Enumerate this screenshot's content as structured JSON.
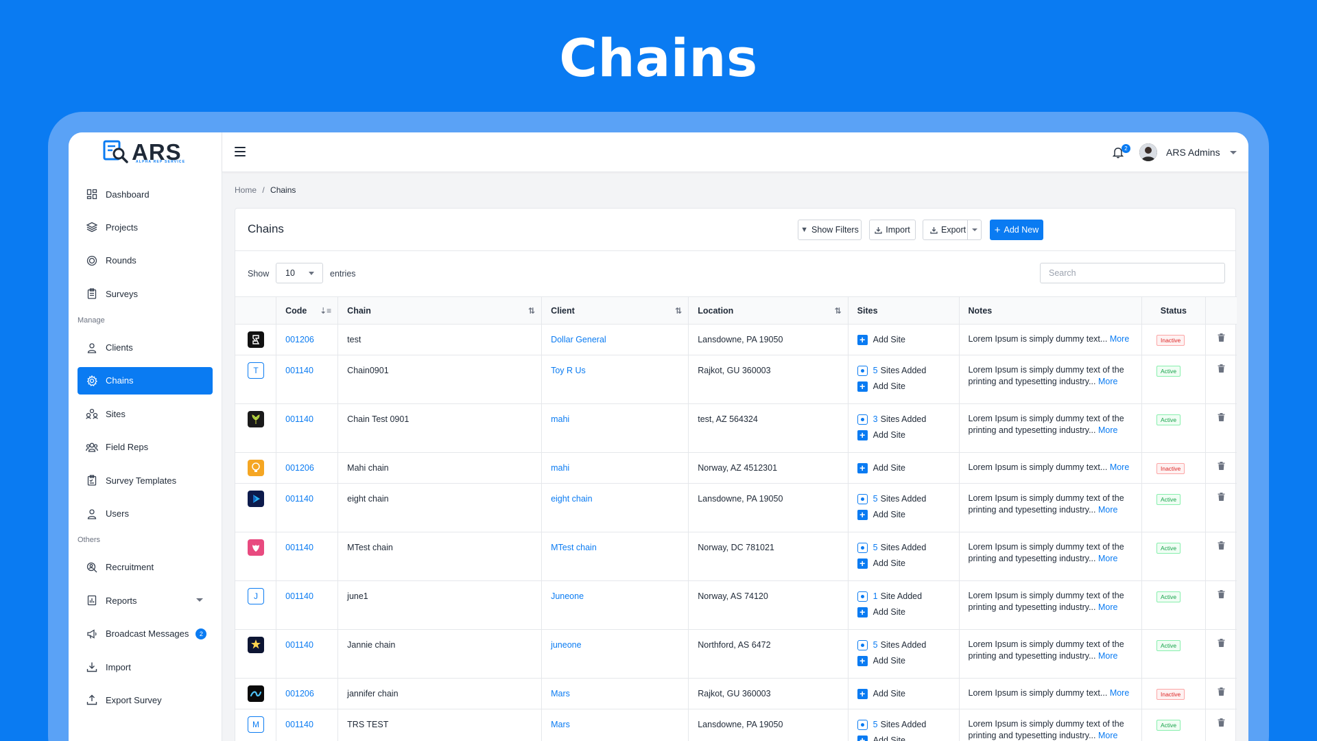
{
  "hero": {
    "title": "Chains"
  },
  "brand": {
    "name": "ARS",
    "tagline": "ALPHA REP SERVICE"
  },
  "sidebar": {
    "items": [
      {
        "label": "Dashboard",
        "icon": "dashboard-icon"
      },
      {
        "label": "Projects",
        "icon": "layers-icon"
      },
      {
        "label": "Rounds",
        "icon": "target-icon"
      },
      {
        "label": "Surveys",
        "icon": "clipboard-icon"
      }
    ],
    "section_manage": "Manage",
    "manage_items": [
      {
        "label": "Clients",
        "icon": "user-icon"
      },
      {
        "label": "Chains",
        "icon": "gear-icon",
        "active": true
      },
      {
        "label": "Sites",
        "icon": "sites-icon"
      },
      {
        "label": "Field Reps",
        "icon": "users-icon"
      },
      {
        "label": "Survey Templates",
        "icon": "clipboard-check-icon"
      },
      {
        "label": "Users",
        "icon": "user-icon"
      }
    ],
    "section_others": "Others",
    "other_items": [
      {
        "label": "Recruitment",
        "icon": "search-user-icon"
      },
      {
        "label": "Reports",
        "icon": "report-icon"
      },
      {
        "label": "Broadcast Messages",
        "icon": "megaphone-icon",
        "badge": "2"
      },
      {
        "label": "Import",
        "icon": "download-icon"
      },
      {
        "label": "Export Survey",
        "icon": "upload-icon"
      }
    ]
  },
  "topbar": {
    "notification_count": "2",
    "user_name": "ARS Admins"
  },
  "breadcrumb": {
    "home": "Home",
    "separator": "/",
    "current": "Chains"
  },
  "page": {
    "title": "Chains",
    "buttons": {
      "filters": "Show Filters",
      "import": "Import",
      "export": "Export",
      "add_new": "Add New"
    },
    "show_label": "Show",
    "entries_value": "10",
    "entries_label": "entries",
    "search_placeholder": "Search"
  },
  "table": {
    "columns": [
      "Code",
      "Chain",
      "Client",
      "Location",
      "Sites",
      "Notes",
      "Status"
    ],
    "add_site_label": "Add Site",
    "more_label": "More",
    "rows": [
      {
        "code": "001206",
        "chain": "test",
        "client": "Dollar General",
        "location": "Lansdowne, PA 19050",
        "sites_count": "",
        "sites_text": "",
        "notes": "Lorem Ipsum is simply dummy text...",
        "status": "Inactive",
        "logo": "dark",
        "logo_color": "#111111"
      },
      {
        "code": "001140",
        "chain": "Chain0901",
        "client": "Toy R Us",
        "location": "Rajkot, GU 360003",
        "sites_count": "5",
        "sites_text": "Sites Added",
        "notes": "Lorem Ipsum is simply dummy text of the printing and typesetting industry...",
        "status": "Active",
        "logo": "T",
        "logo_color": "#0a7bf2"
      },
      {
        "code": "001140",
        "chain": "Chain Test 0901",
        "client": "mahi",
        "location": "test, AZ 564324",
        "sites_count": "3",
        "sites_text": "Sites Added",
        "notes": "Lorem Ipsum is simply dummy text of the printing and typesetting industry...",
        "status": "Active",
        "logo": "leaf",
        "logo_color": "#1a1a1a"
      },
      {
        "code": "001206",
        "chain": "Mahi chain",
        "client": "mahi",
        "location": "Norway, AZ 4512301",
        "sites_count": "",
        "sites_text": "",
        "notes": "Lorem Ipsum is simply dummy text...",
        "status": "Inactive",
        "logo": "bulb",
        "logo_color": "#f5a623"
      },
      {
        "code": "001140",
        "chain": "eight chain",
        "client": "eight chain",
        "location": "Lansdowne, PA 19050",
        "sites_count": "5",
        "sites_text": "Sites Added",
        "notes": "Lorem Ipsum is simply dummy text of the printing and typesetting industry...",
        "status": "Active",
        "logo": "play",
        "logo_color": "#0d1b4c"
      },
      {
        "code": "001140",
        "chain": "MTest chain",
        "client": "MTest chain",
        "location": "Norway, DC 781021",
        "sites_count": "5",
        "sites_text": "Sites Added",
        "notes": "Lorem Ipsum is simply dummy text of the printing and typesetting industry...",
        "status": "Active",
        "logo": "pink",
        "logo_color": "#e84a7f"
      },
      {
        "code": "001140",
        "chain": "june1",
        "client": "Juneone",
        "location": "Norway, AS 74120",
        "sites_count": "1",
        "sites_text": "Site Added",
        "notes": "Lorem Ipsum is simply dummy text of the printing and typesetting industry...",
        "status": "Active",
        "logo": "J",
        "logo_color": "#0a7bf2"
      },
      {
        "code": "001140",
        "chain": "Jannie chain",
        "client": "juneone",
        "location": "Northford, AS 6472",
        "sites_count": "5",
        "sites_text": "Sites Added",
        "notes": "Lorem Ipsum is simply dummy text of the printing and typesetting industry...",
        "status": "Active",
        "logo": "star",
        "logo_color": "#0d1533"
      },
      {
        "code": "001206",
        "chain": "jannifer chain",
        "client": "Mars",
        "location": "Rajkot, GU 360003",
        "sites_count": "",
        "sites_text": "",
        "notes": "Lorem Ipsum is simply dummy text...",
        "status": "Inactive",
        "logo": "wave",
        "logo_color": "#0a0a0a"
      },
      {
        "code": "001140",
        "chain": "TRS TEST",
        "client": "Mars",
        "location": "Lansdowne, PA 19050",
        "sites_count": "5",
        "sites_text": "Sites Added",
        "notes": "Lorem Ipsum is simply dummy text of the printing and typesetting industry...",
        "status": "Active",
        "logo": "M",
        "logo_color": "#0a7bf2"
      }
    ]
  }
}
